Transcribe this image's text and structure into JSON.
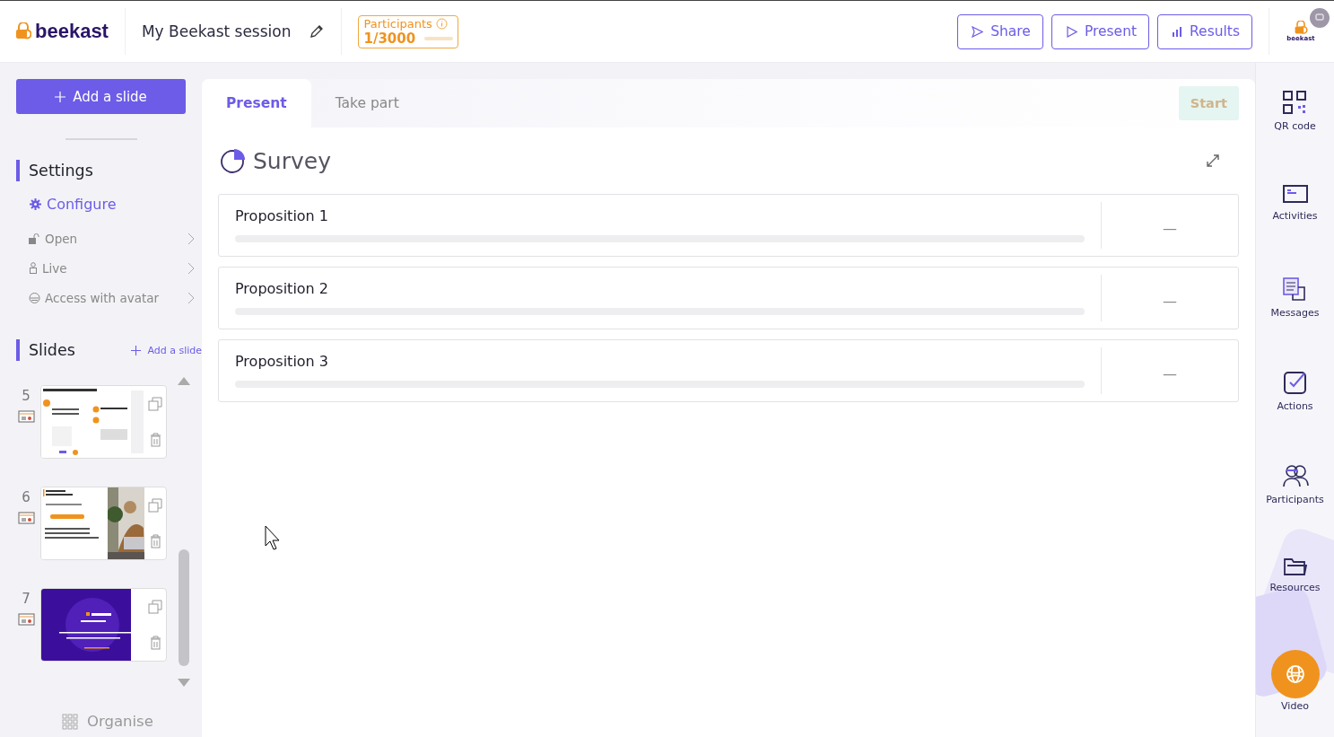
{
  "header": {
    "logo": "beekast",
    "session_title": "My Beekast session",
    "participants": {
      "label": "Participants",
      "count": "1/3000",
      "level": 0
    },
    "buttons": [
      {
        "label": "Share",
        "kind": "share"
      },
      {
        "label": "Present",
        "kind": "play"
      },
      {
        "label": "Results",
        "kind": "bars"
      }
    ],
    "account_logo": "beekast"
  },
  "sidebar": {
    "add_slide_button": "Add a slide",
    "settings_title": "Settings",
    "configure": "Configure",
    "settings_items": [
      {
        "label": "Open",
        "kind": "lock"
      },
      {
        "label": "Live",
        "kind": "person"
      },
      {
        "label": "Access with avatar",
        "kind": "avatar"
      }
    ],
    "slides_title": "Slides",
    "slides_add": "Add a slide",
    "slides": [
      {
        "number": "5",
        "kind": "document"
      },
      {
        "number": "6"
      },
      {
        "number": "7",
        "kind": "dark"
      }
    ],
    "organise": "Organise"
  },
  "main": {
    "tabs": [
      {
        "label": "Present",
        "selected": true
      },
      {
        "label": "Take part",
        "selected": false
      }
    ],
    "start_button": {
      "label": "Start",
      "disabled": true
    },
    "title": "Survey",
    "propositions": [
      {
        "label": "Proposition 1",
        "level": 0,
        "result": "—"
      },
      {
        "label": "Proposition 2",
        "level": 0,
        "result": "—"
      },
      {
        "label": "Proposition 3",
        "level": 0,
        "result": "—"
      }
    ]
  },
  "rail": [
    {
      "label": "QR code",
      "kind": "qr"
    },
    {
      "label": "Activities",
      "kind": "window"
    },
    {
      "label": "Messages",
      "kind": "messages"
    },
    {
      "label": "Actions",
      "kind": "check"
    },
    {
      "label": "Participants",
      "kind": "people"
    },
    {
      "label": "Resources",
      "kind": "folder"
    },
    {
      "label": "Video",
      "kind": "video"
    }
  ]
}
